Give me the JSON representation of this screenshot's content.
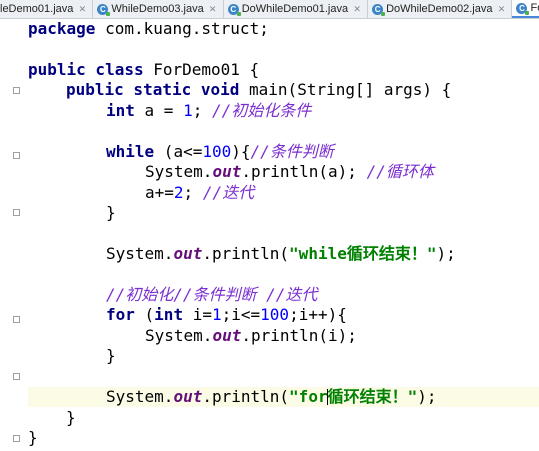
{
  "tabs": [
    {
      "label": "leDemo01.java",
      "active": false
    },
    {
      "label": "WhileDemo03.java",
      "active": false
    },
    {
      "label": "DoWhileDemo01.java",
      "active": false
    },
    {
      "label": "DoWhileDemo02.java",
      "active": false
    },
    {
      "label": "ForD",
      "active": true
    }
  ],
  "code": {
    "l1": {
      "kw": "package",
      "rest": " com.kuang.struct;"
    },
    "l3": {
      "kw1": "public class",
      "rest": " ForDemo01 {"
    },
    "l4": {
      "kw": "public static void",
      "rest": " main(String[] args) {"
    },
    "l5": {
      "kw": "int",
      "a": " a = ",
      "num": "1",
      "semi": "; ",
      "cm": "//初始化条件"
    },
    "l7": {
      "kw": "while",
      "a": " (a<=",
      "num": "100",
      "b": "){",
      "cm": "//条件判断"
    },
    "l8": {
      "a": "System.",
      "fld": "out",
      "b": ".println(a); ",
      "cm": "//循环体"
    },
    "l9": {
      "a": "a+=",
      "num": "2",
      "semi": "; ",
      "cm": "//迭代"
    },
    "l10": {
      "brace": "}"
    },
    "l12": {
      "a": "System.",
      "fld": "out",
      "b": ".println(",
      "st": "\"while循环结束！\"",
      "c": ");"
    },
    "l14": {
      "cm": "//初始化//条件判断 //迭代"
    },
    "l15": {
      "kw": "for",
      "a": " (",
      "kw2": "int",
      "b": " i=",
      "num1": "1",
      "c": ";i<=",
      "num2": "100",
      "d": ";i++){"
    },
    "l16": {
      "a": "System.",
      "fld": "out",
      "b": ".println(i);"
    },
    "l17": {
      "brace": "}"
    },
    "l19": {
      "a": "System.",
      "fld": "out",
      "b": ".println(",
      "st1": "\"for",
      "st2": "循环结束！\"",
      "c": ");"
    },
    "l20": {
      "brace": "}"
    },
    "l21": {
      "brace": "}"
    }
  }
}
